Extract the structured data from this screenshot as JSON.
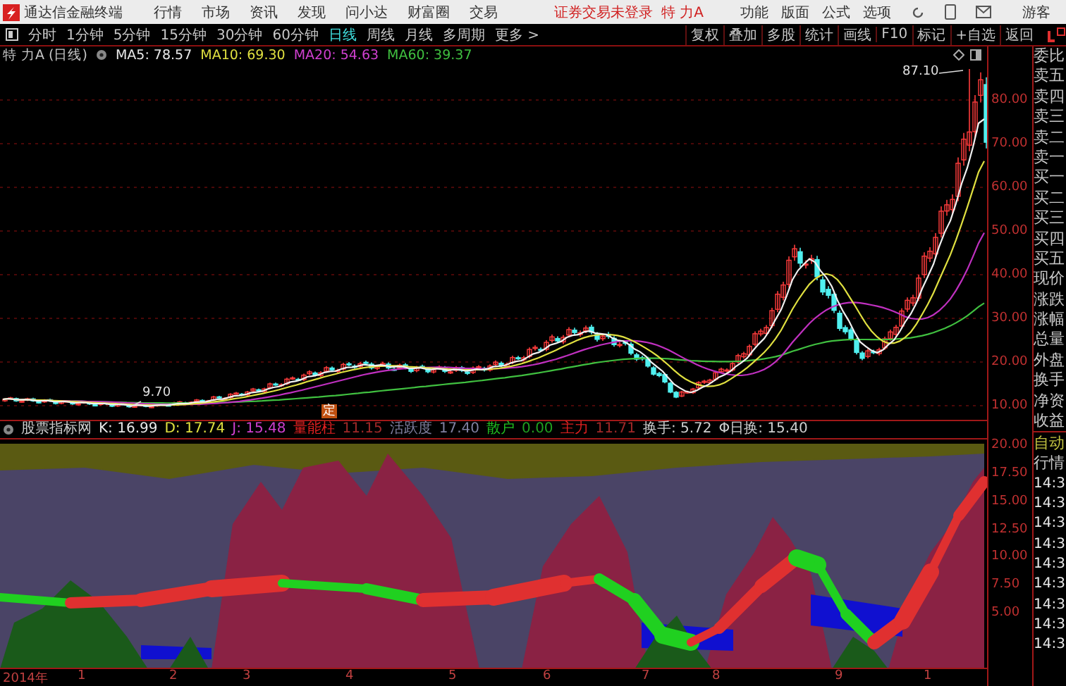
{
  "menu_bar": {
    "app_title": "通达信金融终端",
    "items": [
      "行情",
      "市场",
      "资讯",
      "发现",
      "问小达",
      "财富圈",
      "交易"
    ],
    "notice": "证券交易未登录",
    "stock": "特 力A",
    "tools": [
      "功能",
      "版面",
      "公式",
      "选项"
    ],
    "user": "游客"
  },
  "period_tabs": [
    {
      "label": "分时",
      "selected": false
    },
    {
      "label": "1分钟",
      "selected": false
    },
    {
      "label": "5分钟",
      "selected": false
    },
    {
      "label": "15分钟",
      "selected": false
    },
    {
      "label": "30分钟",
      "selected": false
    },
    {
      "label": "60分钟",
      "selected": false
    },
    {
      "label": "日线",
      "selected": true
    },
    {
      "label": "周线",
      "selected": false
    },
    {
      "label": "月线",
      "selected": false
    },
    {
      "label": "多周期",
      "selected": false
    },
    {
      "label": "更多 >",
      "selected": false
    }
  ],
  "chart_tools": [
    "复权",
    "叠加",
    "多股",
    "统计",
    "画线",
    "F10",
    "标记",
    "+自选",
    "返回"
  ],
  "quote": {
    "title": "特 力A (日线)",
    "ma": [
      {
        "label": "MA5: 78.57",
        "color": "#e8e8e8"
      },
      {
        "label": "MA10: 69.30",
        "color": "#e0e040"
      },
      {
        "label": "MA20: 54.63",
        "color": "#d040d0"
      },
      {
        "label": "MA60: 39.37",
        "color": "#40c040"
      }
    ]
  },
  "price_axis": [
    "80.00",
    "70.00",
    "60.00",
    "50.00",
    "40.00",
    "30.00",
    "20.00",
    "10.00"
  ],
  "annotations": {
    "high": "87.10",
    "low": "9.70",
    "marker": "定"
  },
  "indicator": {
    "name": "股票指标网",
    "values": [
      {
        "kind": "k",
        "text": "K: 16.99"
      },
      {
        "kind": "d",
        "text": "D: 17.74"
      },
      {
        "kind": "j",
        "text": "J: 15.48"
      },
      {
        "kind": "volume",
        "label": "量能柱",
        "value": "11.15"
      },
      {
        "kind": "activity",
        "label": "活跃度",
        "value": "17.40"
      },
      {
        "kind": "retail",
        "label": "散户",
        "value": "0.00"
      },
      {
        "kind": "main",
        "label": "主力",
        "value": "11.71"
      },
      {
        "kind": "turnover",
        "text": "换手: 5.72"
      },
      {
        "kind": "turnover",
        "text": "Φ日换: 15.40"
      }
    ]
  },
  "indicator_axis": [
    "20.00",
    "17.50",
    "15.00",
    "12.50",
    "10.00",
    "7.50",
    "5.00"
  ],
  "date_axis": [
    "2014年",
    "1",
    "2",
    "3",
    "4",
    "5",
    "6",
    "7",
    "8",
    "9",
    "1"
  ],
  "side_panel": {
    "labels": [
      "委比",
      "卖五",
      "卖四",
      "卖三",
      "卖二",
      "卖一",
      "买一",
      "买二",
      "买三",
      "买四",
      "买五",
      "现价",
      "涨跌",
      "涨幅",
      "总量",
      "外盘",
      "换手",
      "净资",
      "收益"
    ],
    "status": "自动",
    "section": "行情",
    "times": [
      "14:3",
      "14:3",
      "14:3",
      "14:3",
      "14:3",
      "14:3",
      "14:3",
      "14:3",
      "14:3"
    ]
  }
}
